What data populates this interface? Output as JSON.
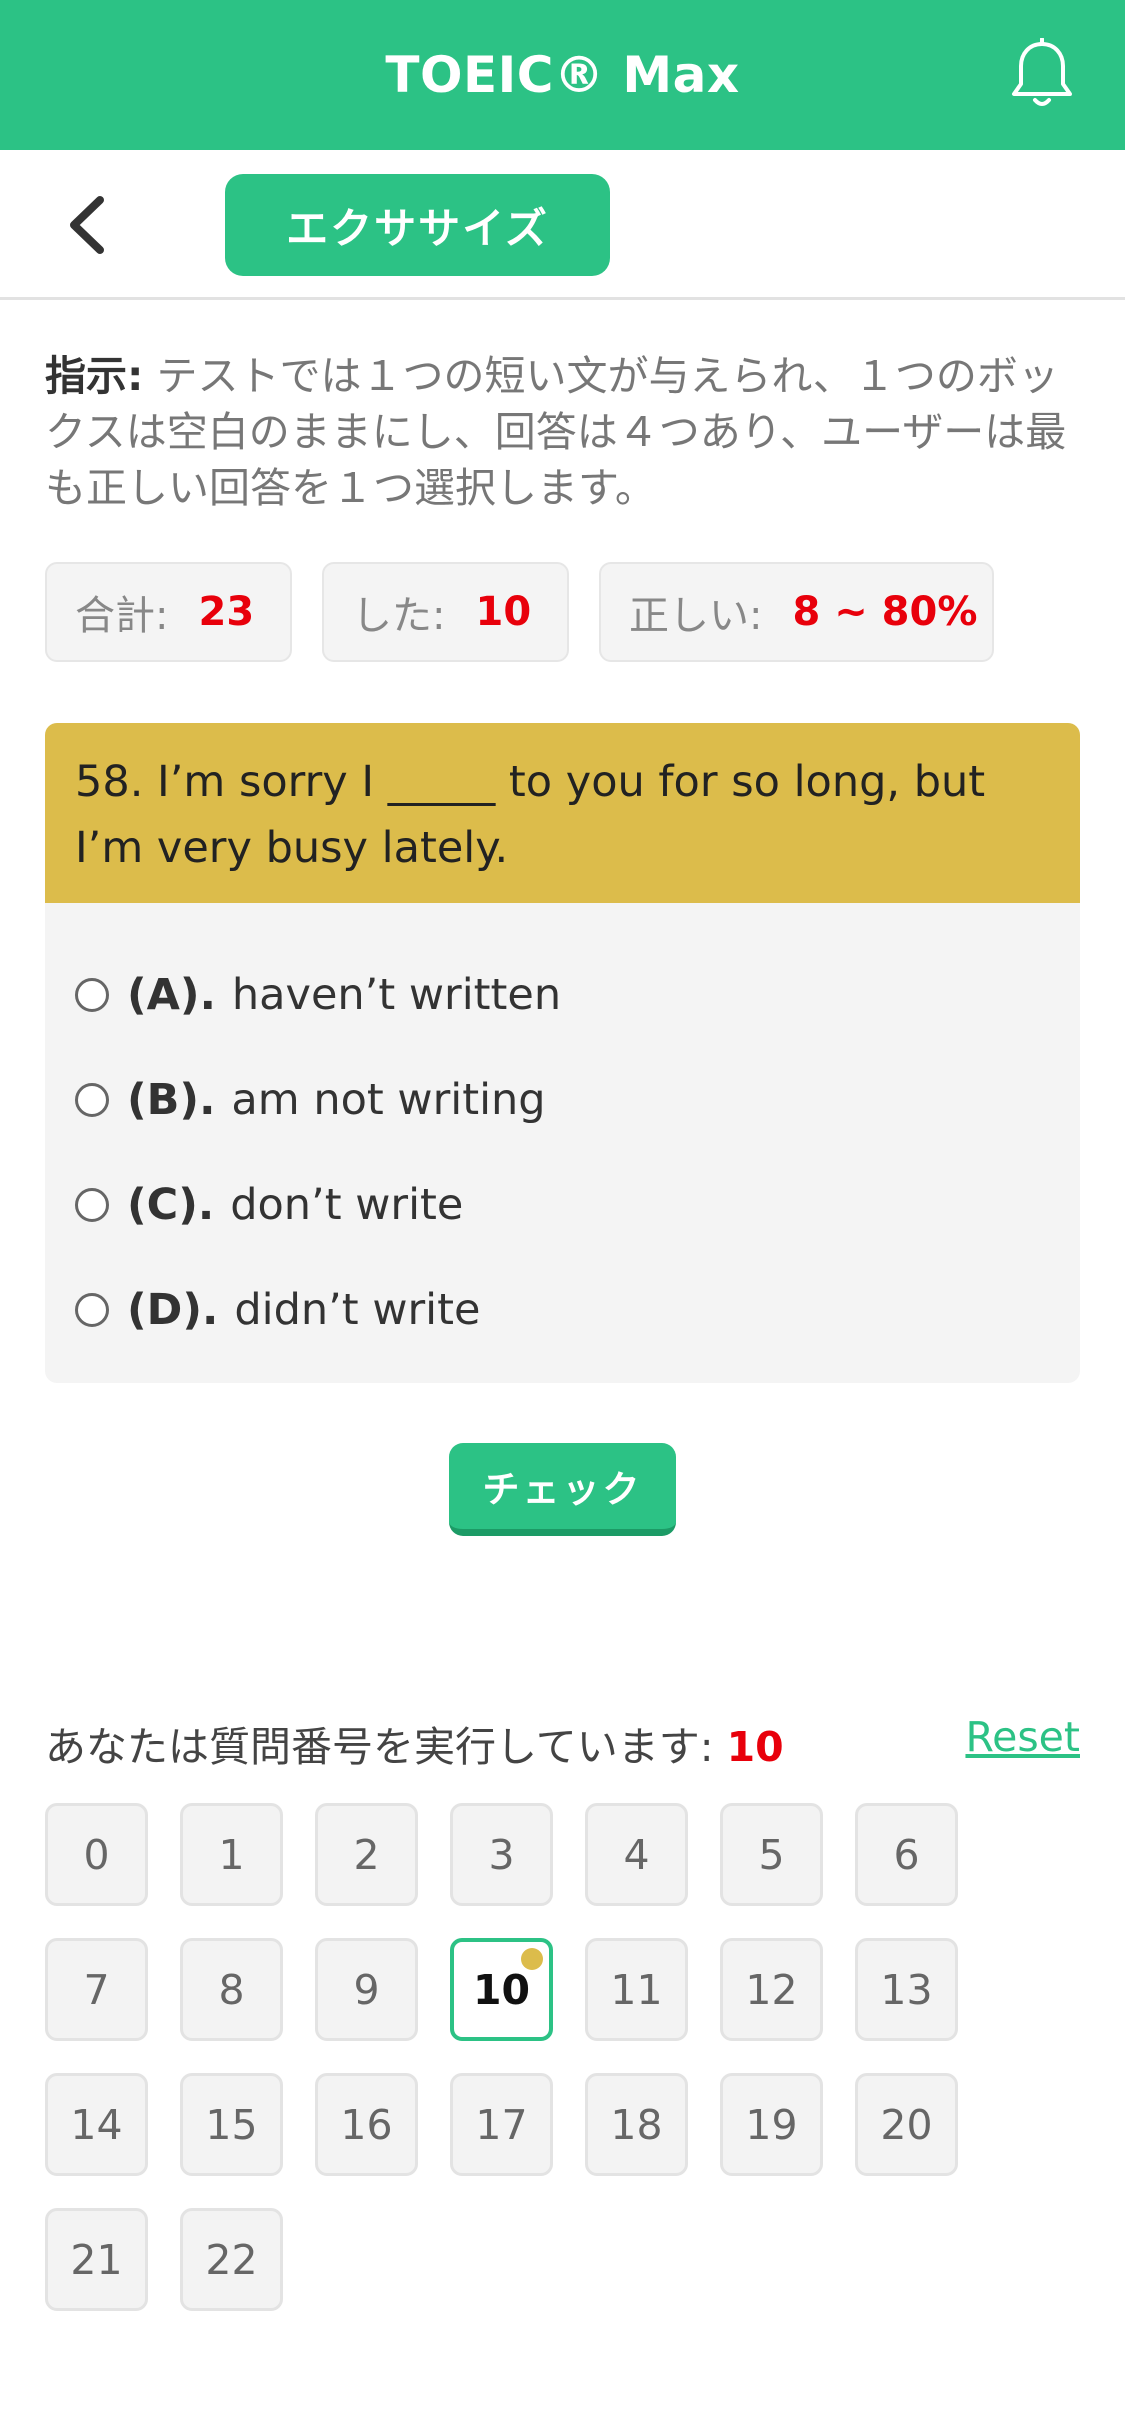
{
  "header": {
    "title": "TOEIC® Max",
    "bell_icon": "bell-icon"
  },
  "subheader": {
    "back_icon": "chevron-left-icon",
    "tab_label": "エクササイズ"
  },
  "instruction": {
    "label": "指示:",
    "text": " テストでは１つの短い文が与えられ、１つのボックスは空白のままにし、回答は４つあり、ユーザーは最も正しい回答を１つ選択します。"
  },
  "stats": [
    {
      "label": "合計:",
      "value": "23"
    },
    {
      "label": "した:",
      "value": "10"
    },
    {
      "label": "正しい:",
      "value": "8 ~ 80%"
    }
  ],
  "question": {
    "text": "58. I’m sorry I _____ to you for so long, but I’m very busy lately.",
    "options": [
      {
        "letter": "(A).",
        "text": "haven’t written"
      },
      {
        "letter": "(B).",
        "text": "am not writing"
      },
      {
        "letter": "(C).",
        "text": "don’t write"
      },
      {
        "letter": "(D).",
        "text": "didn’t write"
      }
    ]
  },
  "check_button": "チェック",
  "progress": {
    "label": "あなたは質問番号を実行しています:",
    "current": "10",
    "reset": "Reset"
  },
  "question_numbers": [
    "0",
    "1",
    "2",
    "3",
    "4",
    "5",
    "6",
    "7",
    "8",
    "9",
    "10",
    "11",
    "12",
    "13",
    "14",
    "15",
    "16",
    "17",
    "18",
    "19",
    "20",
    "21",
    "22"
  ],
  "colors": {
    "brand_green": "#2cc285",
    "question_yellow": "#dcbc4b",
    "accent_red": "#e8000b"
  }
}
